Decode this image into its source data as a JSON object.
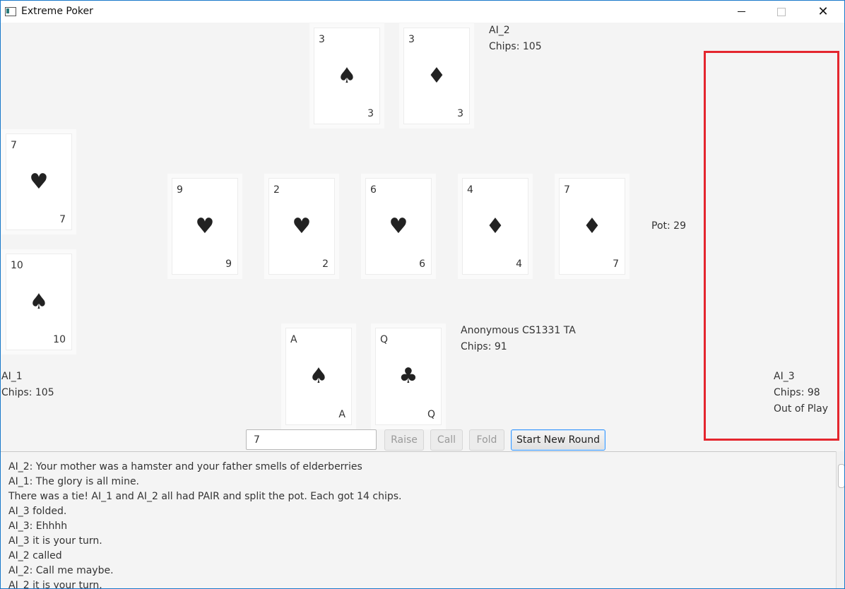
{
  "window": {
    "title": "Extreme Poker",
    "icons": [
      "app-icon",
      "minimize-icon",
      "maximize-icon",
      "close-icon"
    ]
  },
  "players": {
    "ai2": {
      "name": "AI_2",
      "chips": "Chips: 105",
      "cards": [
        {
          "rank": "3",
          "suit": "♠"
        },
        {
          "rank": "3",
          "suit": "♦"
        }
      ]
    },
    "ai1": {
      "name": "AI_1",
      "chips": "Chips: 105",
      "cards": [
        {
          "rank": "7",
          "suit": "♥"
        },
        {
          "rank": "10",
          "suit": "♠"
        }
      ]
    },
    "ai3": {
      "name": "AI_3",
      "chips": "Chips: 98",
      "status": "Out of Play"
    },
    "human": {
      "name": "Anonymous CS1331 TA",
      "chips": "Chips: 91",
      "cards": [
        {
          "rank": "A",
          "suit": "♠"
        },
        {
          "rank": "Q",
          "suit": "♣"
        }
      ]
    }
  },
  "community": [
    {
      "rank": "9",
      "suit": "♥"
    },
    {
      "rank": "2",
      "suit": "♥"
    },
    {
      "rank": "6",
      "suit": "♥"
    },
    {
      "rank": "4",
      "suit": "♦"
    },
    {
      "rank": "7",
      "suit": "♦"
    }
  ],
  "pot": "Pot: 29",
  "controls": {
    "bet_value": "7",
    "raise_label": "Raise",
    "call_label": "Call",
    "fold_label": "Fold",
    "new_round_label": "Start New Round"
  },
  "log": [
    "AI_2: Your mother was a hamster and your father smells of elderberries",
    "AI_1: The glory is all mine.",
    "There was a tie! AI_1 and AI_2 all had PAIR and split the pot. Each got 14 chips.",
    "AI_3 folded.",
    "AI_3: Ehhhh",
    "AI_3 it is your turn.",
    "AI_2 called",
    "AI_2: Call me maybe.",
    "AI_2 it is your turn."
  ]
}
